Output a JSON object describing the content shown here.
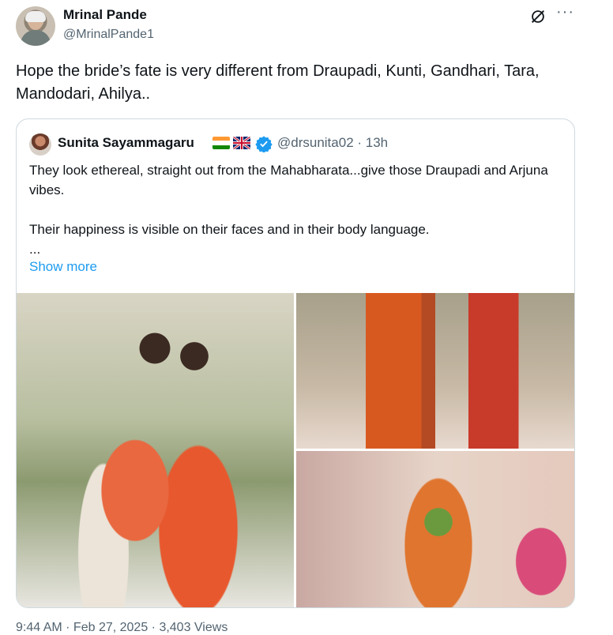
{
  "author": {
    "name": "Mrinal Pande",
    "handle": "@MrinalPande1"
  },
  "tweet": {
    "text": "Hope the bride’s fate is very different from Draupadi, Kunti, Gandhari, Tara, Mandodari, Ahilya..",
    "footer": "9:44 AM · Feb 27, 2025 · 3,403 Views"
  },
  "icons": {
    "grok": "grok-icon",
    "more": "more-options-icon",
    "verified": "verified-badge-icon"
  },
  "colors": {
    "link": "#1d9bf0",
    "muted": "#536471",
    "border": "#cfd9de"
  },
  "quoted": {
    "name": "Sunita Sayammagaru",
    "handle_time": "@drsunita02 · 13h",
    "paragraph1": "They look ethereal, straight out from the Mahabharata...give those Draupadi and Arjuna vibes.",
    "paragraph2": "Their happiness is visible on their faces and in their body language.",
    "ellipsis": "...",
    "show_more": "Show more"
  }
}
